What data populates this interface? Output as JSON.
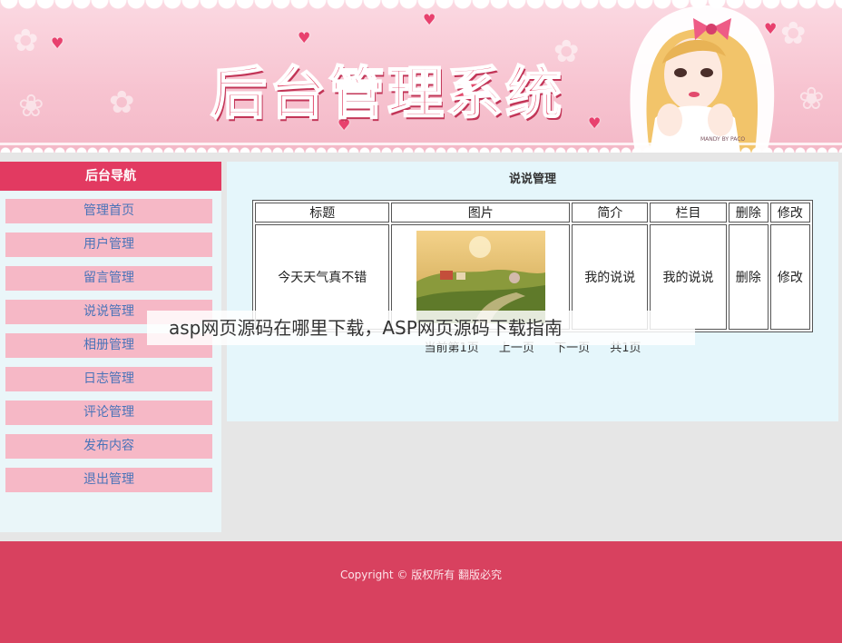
{
  "header": {
    "title": "后台管理系统",
    "credit": "MANDY BY PACO"
  },
  "sidebar": {
    "title": "后台导航",
    "items": [
      {
        "label": "管理首页"
      },
      {
        "label": "用户管理"
      },
      {
        "label": "留言管理"
      },
      {
        "label": "说说管理"
      },
      {
        "label": "相册管理"
      },
      {
        "label": "日志管理"
      },
      {
        "label": "评论管理"
      },
      {
        "label": "发布内容"
      },
      {
        "label": "退出管理"
      }
    ]
  },
  "main": {
    "title": "说说管理",
    "table": {
      "headers": [
        "标题",
        "图片",
        "简介",
        "栏目",
        "删除",
        "修改"
      ],
      "row": {
        "title": "今天天气真不错",
        "intro": "我的说说",
        "column": "我的说说",
        "delete": "删除",
        "edit": "修改"
      }
    },
    "pager": {
      "current": "当前第1页",
      "prev": "上一页",
      "next": "下一页",
      "total": "共1页"
    }
  },
  "overlay": {
    "caption": "asp网页源码在哪里下载，ASP网页源码下载指南"
  },
  "footer": {
    "copyright": "Copyright © 版权所有 翻版必究"
  },
  "colors": {
    "accent": "#e23a61",
    "footer": "#d8415f",
    "nav_item": "#f6b8c6",
    "nav_text": "#4a73b8",
    "content_bg": "#e5f6fb"
  }
}
